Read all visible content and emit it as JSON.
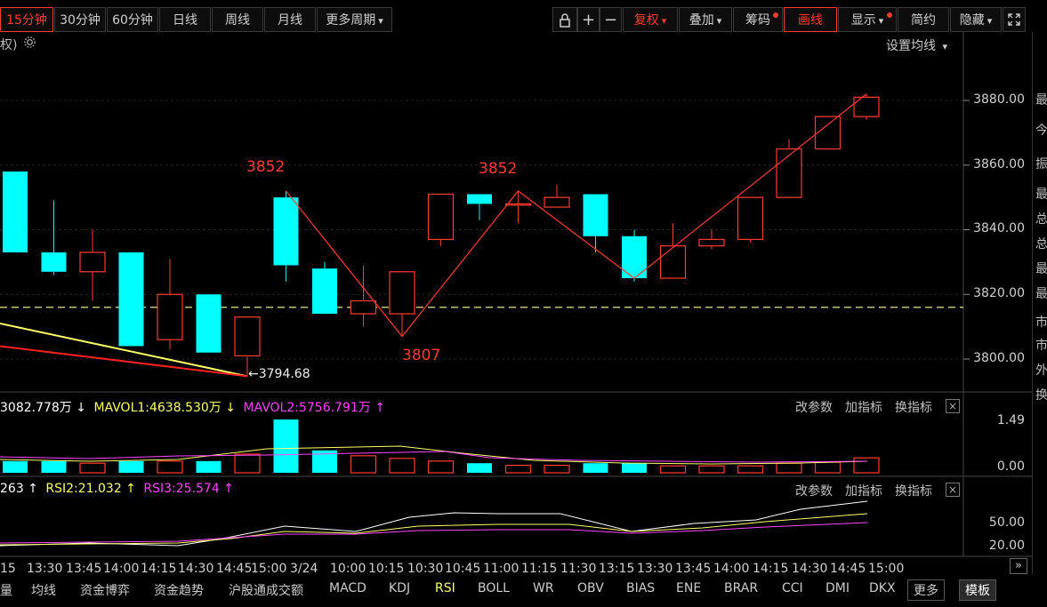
{
  "toolbar": {
    "periods": [
      "15分钟",
      "30分钟",
      "60分钟",
      "日线",
      "周线",
      "月线",
      "更多周期"
    ],
    "active_period": "15分钟",
    "right": {
      "lock": "lock-icon",
      "plus": "+",
      "minus": "−",
      "fuquan": "复权",
      "overlay": "叠加",
      "chips": "筹码",
      "draw": "画线",
      "display": "显示",
      "simple": "简约",
      "hide": "隐藏",
      "expand": "expand-icon"
    }
  },
  "main_chart": {
    "legend_left": "权)",
    "ma_setting": "设置均线",
    "price_ticks": [
      "3880.00",
      "3860.00",
      "3840.00",
      "3820.00",
      "3800.00"
    ],
    "annotations": {
      "peak1": "3852",
      "peak2": "3852",
      "trough": "3807",
      "low_marker": "←3794.68"
    },
    "dashed_level": 3816
  },
  "chart_data": {
    "type": "candlestick",
    "categories": [
      "c1",
      "c2",
      "c3",
      "c4",
      "c5",
      "c6",
      "c7",
      "c8",
      "c9",
      "c10",
      "c11",
      "c12",
      "c13",
      "c14",
      "c15",
      "c16",
      "c17",
      "c18",
      "c19",
      "c20",
      "c21",
      "c22"
    ],
    "ohlc": [
      [
        3858,
        3858,
        3833,
        3833
      ],
      [
        3833,
        3849,
        3826,
        3827
      ],
      [
        3827,
        3840,
        3818,
        3833
      ],
      [
        3833,
        3833,
        3804,
        3804
      ],
      [
        3806,
        3831,
        3803,
        3820
      ],
      [
        3820,
        3820,
        3802,
        3802
      ],
      [
        3801,
        3813,
        3795,
        3813
      ],
      [
        3850,
        3852,
        3824,
        3829
      ],
      [
        3828,
        3830,
        3814,
        3814
      ],
      [
        3814,
        3829,
        3810,
        3818
      ],
      [
        3814,
        3827,
        3807,
        3827
      ],
      [
        3837,
        3851,
        3835,
        3851
      ],
      [
        3851,
        3851,
        3843,
        3848
      ],
      [
        3848,
        3852,
        3842,
        3848
      ],
      [
        3847,
        3854,
        3847,
        3850
      ],
      [
        3851,
        3851,
        3833,
        3838
      ],
      [
        3838,
        3840,
        3824,
        3825
      ],
      [
        3825,
        3842,
        3825,
        3835
      ],
      [
        3835,
        3840,
        3834,
        3837
      ],
      [
        3837,
        3850,
        3836,
        3850
      ],
      [
        3850,
        3868,
        3850,
        3865
      ],
      [
        3865,
        3875,
        3865,
        3875
      ],
      [
        3875,
        3882,
        3874,
        3881
      ]
    ],
    "ylim": [
      3790,
      3895
    ],
    "volume_header": {
      "vol": "3082.778万",
      "mavol1": "MAVOL1:4638.530万",
      "mavol2": "MAVOL2:5756.791万"
    },
    "volume_ticks": [
      "1.49",
      "0.00"
    ],
    "rsi_header": {
      "rsi1": "263",
      "rsi2": "RSI2:21.032",
      "rsi3": "RSI3:25.574"
    },
    "rsi_ticks": [
      "50.00",
      "20.00"
    ]
  },
  "subpanels": {
    "actions": [
      "改参数",
      "加指标",
      "换指标"
    ],
    "close": "×"
  },
  "time_axis": [
    "15",
    "13:30",
    "13:45",
    "14:00",
    "14:15",
    "14:30",
    "14:45",
    "15:00",
    "3/24",
    "10:00",
    "10:15",
    "10:30",
    "10:45",
    "11:00",
    "11:15",
    "11:30",
    "13:15",
    "13:30",
    "13:45",
    "14:00",
    "14:15",
    "14:30",
    "14:45",
    "15:00"
  ],
  "indicator_tabs": [
    "量",
    "均线",
    "资金博弈",
    "资金趋势",
    "沪股通成交额",
    "MACD",
    "KDJ",
    "RSI",
    "BOLL",
    "WR",
    "OBV",
    "BIAS",
    "ENE",
    "BRAR",
    "CCI",
    "DMI",
    "DKX"
  ],
  "active_tab": "RSI",
  "more_tab": "更多",
  "template_tab": "模板",
  "side_labels": [
    "最",
    "今",
    "振",
    "最",
    "总",
    "总",
    "最",
    "最",
    "市",
    "市",
    "外",
    "换"
  ],
  "colors": {
    "up": "#ff3b30",
    "down": "#00ffff",
    "ma_yellow": "#ffff66",
    "ma_magenta": "#ff44ff",
    "ma_white": "#ffffff"
  }
}
